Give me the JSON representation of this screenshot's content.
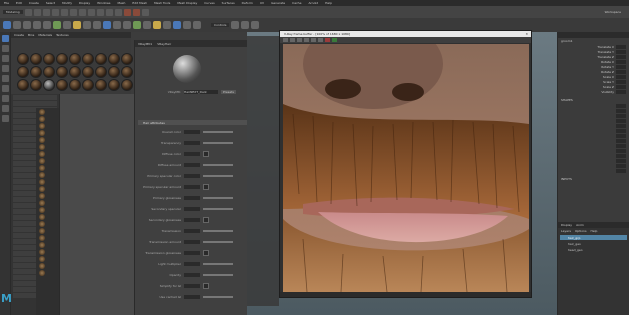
{
  "colors": {
    "accent": "#4a78b8",
    "selection": "#5285a6",
    "logo": "#3aa0c8"
  },
  "menubar": {
    "items": [
      "File",
      "Edit",
      "Create",
      "Select",
      "Modify",
      "Display",
      "Windows",
      "Mesh",
      "Edit Mesh",
      "Mesh Tools",
      "Mesh Display",
      "Curves",
      "Surfaces",
      "Deform",
      "UV",
      "Generate",
      "Cache",
      "Arnold",
      "Help"
    ]
  },
  "statusline": {
    "mode": "Modeling",
    "workspace": "Workspace"
  },
  "shelf": {
    "active_tab": "Controls"
  },
  "hypershade": {
    "tabs": [
      "Create",
      "Bins",
      "Materials",
      "Textures"
    ]
  },
  "attribute_editor": {
    "tabs": [
      "VRayMtl1",
      "VRayHair"
    ],
    "material_name": "HairNEXT_Dark",
    "section": "Hair attributes",
    "rows": [
      "Overall color",
      "Transparency",
      "Diffuse color",
      "Diffuse amount",
      "Primary specular color",
      "Primary specular amount",
      "Primary glossiness",
      "Secondary specular",
      "Secondary glossiness",
      "Transmission",
      "Transmission amount",
      "Transmission glossiness",
      "Light multiplier",
      "Opacity",
      "Simplify for GI",
      "Use cached GI"
    ],
    "presets_label": "Presets"
  },
  "vfb": {
    "title": "V-Ray frame buffer - [100% of 1680 x 1080]"
  },
  "channel_box": {
    "object": "groom1",
    "section_shapes": "SHAPES",
    "section_inputs": "INPUTS",
    "attrs": [
      "Translate X",
      "Translate Y",
      "Translate Z",
      "Rotate X",
      "Rotate Y",
      "Rotate Z",
      "Scale X",
      "Scale Y",
      "Scale Z",
      "Visibility"
    ]
  },
  "layers": {
    "tabs": [
      "Display",
      "Anim"
    ],
    "menu": [
      "Layers",
      "Options",
      "Help"
    ],
    "items": [
      "hair_grp",
      "hair_geo",
      "head_geo"
    ]
  },
  "logo": "M"
}
